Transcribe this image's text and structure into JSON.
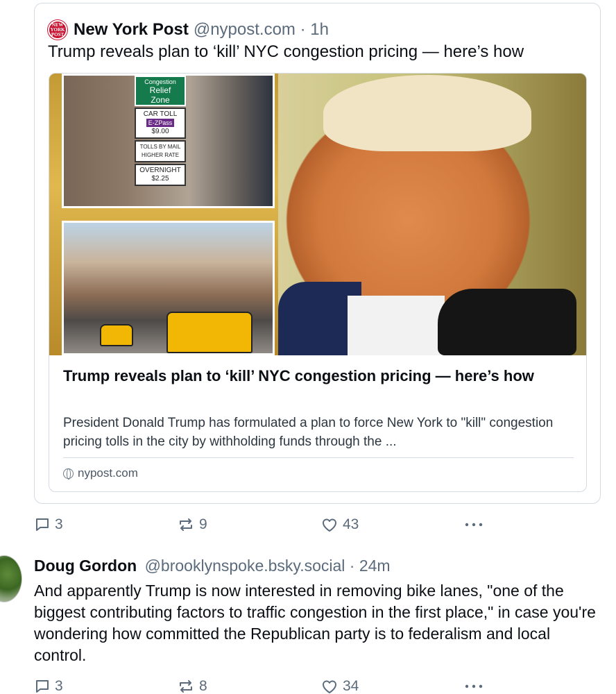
{
  "quoted_post": {
    "logo_text": "NEW YORK POST",
    "author_name": "New York Post",
    "handle_time": "@nypost.com · 1h",
    "text": "Trump reveals plan to ‘kill’ NYC congestion pricing — here’s how",
    "embed": {
      "sign": {
        "zone_line1": "Congestion",
        "zone_line2": "Relief",
        "zone_line3": "Zone",
        "car_toll": "CAR TOLL",
        "ezpass": "E-ZPass",
        "price1": "$9.00",
        "tolls_by_mail": "TOLLS BY MAIL HIGHER RATE",
        "overnight": "OVERNIGHT",
        "price2": "$2.25"
      },
      "title": "Trump reveals plan to ‘kill’ NYC congestion pricing — here’s how",
      "description": "President Donald Trump has formulated a plan to force New York to \"kill\" congestion pricing tolls in the city by withholding funds through the ...",
      "domain": "nypost.com"
    }
  },
  "post1_actions": {
    "replies": "3",
    "reposts": "9",
    "likes": "43"
  },
  "post2": {
    "author_name": "Doug Gordon",
    "handle_time": "@brooklynspoke.bsky.social · 24m",
    "text": "And apparently Trump is now interested in removing bike lanes, \"one of the biggest contributing factors to traffic congestion in the first place,\" in case you're wondering how committed the Republican party is to federalism and local control."
  },
  "post2_actions": {
    "replies": "3",
    "reposts": "8",
    "likes": "34"
  },
  "icons": {
    "reply": "reply-icon",
    "repost": "repost-icon",
    "like": "heart-icon",
    "more": "more-dots-icon"
  }
}
